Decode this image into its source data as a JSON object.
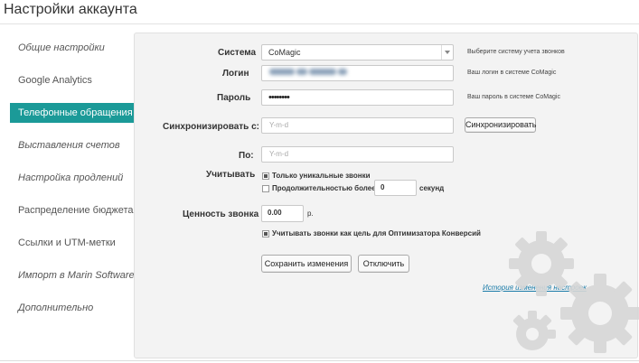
{
  "page": {
    "title": "Настройки аккаунта"
  },
  "sidebar": {
    "items": [
      {
        "label": "Общие настройки",
        "italic": true
      },
      {
        "label": "Google Analytics",
        "italic": false
      },
      {
        "label": "Телефонные обращения",
        "active": true
      },
      {
        "label": "Выставления счетов",
        "italic": true
      },
      {
        "label": "Настройка продлений",
        "italic": true
      },
      {
        "label": "Распределение бюджета",
        "italic": false
      },
      {
        "label": "Ссылки и UTM-метки",
        "italic": false
      },
      {
        "label": "Импорт в Marin Software",
        "italic": true
      },
      {
        "label": "Дополнительно",
        "italic": true
      }
    ]
  },
  "form": {
    "system": {
      "label": "Система",
      "value": "CoMagic",
      "hint": "Выберите систему учета звонков"
    },
    "login": {
      "label": "Логин",
      "hint": "Ваш логин в системе CoMagic"
    },
    "password": {
      "label": "Пароль",
      "value": "••••••••",
      "hint": "Ваш пароль в системе CoMagic"
    },
    "sync_from": {
      "label": "Синхронизировать с:",
      "placeholder": "Y-m-d",
      "button": "Синхронизировать"
    },
    "sync_to": {
      "label": "По:",
      "placeholder": "Y-m-d"
    },
    "account": {
      "label": "Учитывать",
      "unique_label": "Только уникальные звонки",
      "unique_checked": true,
      "duration_label": "Продолжительностью более",
      "duration_checked": false,
      "duration_value": "0",
      "duration_unit": "секунд"
    },
    "call_value": {
      "label": "Ценность звонка",
      "value": "0.00",
      "unit": "р."
    },
    "goal": {
      "label": "Учитывать звонки как цель для Оптимизатора Конверсий",
      "checked": true
    },
    "save_button": "Сохранить изменения",
    "disconnect_button": "Отключить",
    "history_link": "История изменения настроек"
  }
}
